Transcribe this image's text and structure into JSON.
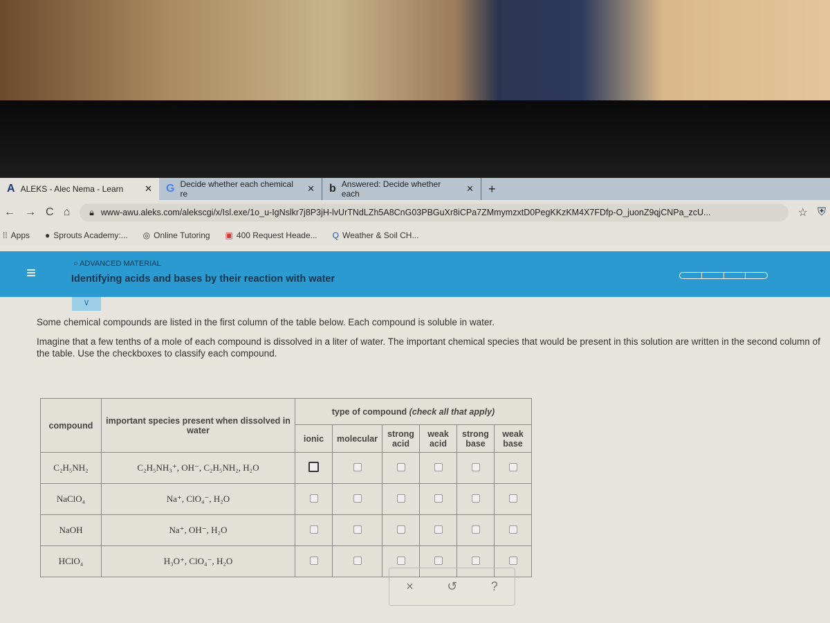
{
  "browser": {
    "tabs": [
      {
        "icon": "A",
        "label": "ALEKS - Alec Nema - Learn"
      },
      {
        "icon": "G",
        "label": "Decide whether each chemical re"
      },
      {
        "icon": "b",
        "label": "Answered: Decide whether each"
      }
    ],
    "url": "www-awu.aleks.com/alekscgi/x/Isl.exe/1o_u-IgNslkr7j8P3jH-lvUrTNdLZh5A8CnG03PBGuXr8iCPa7ZMmymzxtD0PegKKzKM4X7FDfp-O_juonZ9qjCNPa_zcU...",
    "bookmarks": [
      "Apps",
      "Sprouts Academy:...",
      "Online Tutoring",
      "400 Request Heade...",
      "Weather & Soil CH..."
    ]
  },
  "header": {
    "badge": "ADVANCED MATERIAL",
    "title": "Identifying acids and bases by their reaction with water",
    "accent": "#2b9ad0"
  },
  "intro": [
    "Some chemical compounds are listed in the first column of the table below. Each compound is soluble in water.",
    "Imagine that a few tenths of a mole of each compound is dissolved in a liter of water. The important chemical species that would be present in this solution are written in the second column of the table. Use the checkboxes to classify each compound."
  ],
  "table": {
    "col_compound": "compound",
    "col_species": "important species present when dissolved in water",
    "col_type": "type of compound",
    "col_type_note": "(check all that apply)",
    "types": [
      "ionic",
      "molecular",
      "strong acid",
      "weak acid",
      "strong base",
      "weak base"
    ],
    "rows": [
      {
        "compound": "C₂H₅NH₂",
        "species": "C₂H₅NH₃⁺, OH⁻, C₂H₅NH₂, H₂O"
      },
      {
        "compound": "NaClO₄",
        "species": "Na⁺, ClO₄⁻, H₂O"
      },
      {
        "compound": "NaOH",
        "species": "Na⁺, OH⁻, H₂O"
      },
      {
        "compound": "HClO₄",
        "species": "H₃O⁺, ClO₄⁻, H₂O"
      }
    ]
  },
  "actions": {
    "clear": "×",
    "undo": "↺",
    "help": "?"
  }
}
